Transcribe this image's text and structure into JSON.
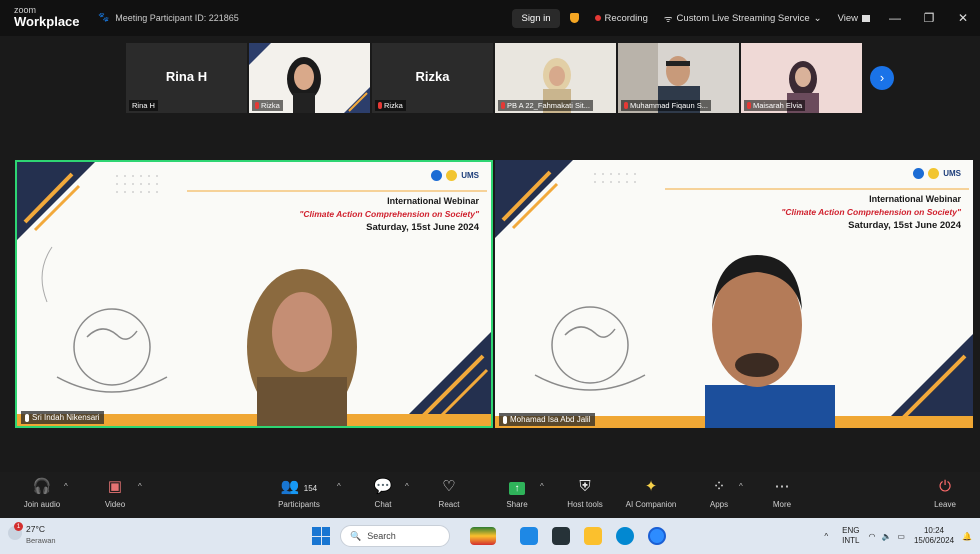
{
  "titlebar": {
    "brand_top": "zoom",
    "brand_bottom": "Workplace",
    "meeting_id": "Meeting Participant ID: 221865",
    "sign_in": "Sign in",
    "recording": "Recording",
    "streaming": "Custom Live Streaming Service",
    "view": "View",
    "minimize": "—",
    "restore": "❐",
    "close": "✕"
  },
  "participants_strip": [
    {
      "big": "Rina H",
      "tag": "Rina H",
      "muted": false
    },
    {
      "big": "",
      "tag": "Rizka",
      "muted": true
    },
    {
      "big": "Rizka",
      "tag": "Rizka",
      "muted": true
    },
    {
      "big": "",
      "tag": "PB A 22_Fahmakati Sit...",
      "muted": true
    },
    {
      "big": "",
      "tag": "Muhammad Fiqaun S...",
      "muted": true
    },
    {
      "big": "",
      "tag": "Maisarah Elvia",
      "muted": true
    }
  ],
  "slide": {
    "logos_text": "UMS",
    "title": "International Webinar",
    "quote": "\"Climate Action Comprehension on Society\"",
    "date": "Saturday, 15st June 2024"
  },
  "videos": {
    "left_name": "Sri Indah Nikensari",
    "right_name": "Mohamad Isa Abd Jalil"
  },
  "toolbar": {
    "join_audio": "Join audio",
    "video": "Video",
    "participants": "Participants",
    "participants_count": "154",
    "chat": "Chat",
    "react": "React",
    "share": "Share",
    "host_tools": "Host tools",
    "ai_companion": "AI Companion",
    "apps": "Apps",
    "more": "More",
    "leave": "Leave"
  },
  "taskbar": {
    "temperature": "27°C",
    "weather": "Berawan",
    "weather_badge": "1",
    "search": "Search",
    "lang_top": "ENG",
    "lang_bottom": "INTL",
    "time": "10:24",
    "date": "15/06/2024"
  },
  "colors": {
    "active_speaker": "#2ed573",
    "recording": "#e53935",
    "accent": "#1a73e8",
    "slide_red": "#d0212e"
  }
}
